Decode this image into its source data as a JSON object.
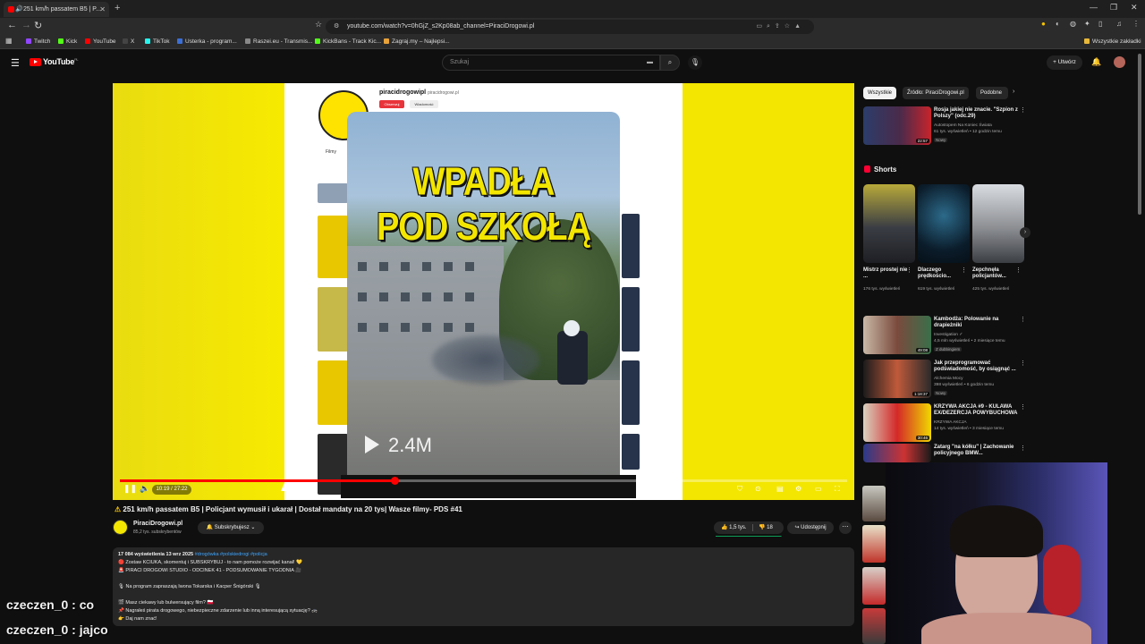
{
  "browser": {
    "tab_title": "251 km/h passatem B5 | P...",
    "url": "youtube.com/watch?v=0hGjZ_s2Kp08ab_channel=PiraciDrogowi.pl",
    "bookmarks": [
      "Twitch",
      "Kick",
      "YouTube",
      "X",
      "TikTok",
      "Usterka - program...",
      "Raszei.eu - Transmis...",
      "KickBans - Track Kic...",
      "Zagraj.my – Najlepsi..."
    ],
    "all_bookmarks": "Wszystkie zakładki"
  },
  "youtube": {
    "logo_word": "YouTube",
    "logo_region": "PL",
    "search_placeholder": "Szukaj",
    "create_label": "Utwórz"
  },
  "player": {
    "page_channel_name": "piracidrogowipl",
    "page_channel_handle": "piracidrogowi.pl",
    "page_subscribe": "Obserwuj",
    "page_message": "Wiadomość",
    "page_tab": "Filmy",
    "overlay_title_line1": "WPADŁA",
    "overlay_title_line2": "POD SZKOŁĄ",
    "overlay_views": "2.4M",
    "time": "10:19 / 27:22",
    "progress_fraction": 0.377
  },
  "video": {
    "title_warn": "⚠",
    "title": "251 km/h passatem B5 | Policjant wymusił i ukarał | Dostał mandaty na 20 tys| Wasze filmy- PDS #41",
    "channel": "PiraciDrogowi.pl",
    "subscribers": "85,2 tys. subskrybentów",
    "subscribed_label": "Subskrybujesz",
    "likes": "1,5 tys.",
    "dislikes": "18",
    "share_label": "Udostępnij",
    "like_ratio": 0.99
  },
  "description": {
    "meta": "17 084 wyświetlenia  13 wrz 2025",
    "tags": "#drogówka #polskiedrogi #policja",
    "lines": [
      "🔴 Zostaw KCIUKA, skomentuj i SUBSKRYBUJ - to nam pomoże rozwijać kanał! 💛",
      "🚨 PIRACI DROGOWI STUDIO - ODCINEK 41 - PODSUMOWANIE TYGODNIA 🎥",
      "",
      "🎙 Na program zapraszają Iwona Tokarska i Kacper Śnigórski 🎙",
      "",
      "🎬 Masz ciekawy lub bulwersujący film? 🇵🇱",
      "📌 Nagrałeś pirata drogowego, niebezpieczne zdarzenie lub inną interesującą sytuację? 🚓",
      "👉 Daj nam znać!"
    ]
  },
  "sidebar": {
    "chips": [
      "Wszystkie",
      "Źródło: PiraciDrogowi.pl",
      "Podobne"
    ],
    "top_video": {
      "title": "Rosja jakiej nie znacie. \"Szpion z Polszy\" (odc.29)",
      "channel": "Autostopem Na Koniec Świata",
      "meta": "61 tys. wyświetleń • 12 godzin temu",
      "badge": "Nowy",
      "duration": "22:57"
    },
    "shorts_heading": "Shorts",
    "shorts": [
      {
        "title": "Mistrz prostej nie ...",
        "views": "176 tys. wyświetleń"
      },
      {
        "title": "Dlaczego prędkościo...",
        "views": "619 tys. wyświetleń"
      },
      {
        "title": "Zepchnęła policjantów...",
        "views": "425 tys. wyświetleń"
      }
    ],
    "videos": [
      {
        "title": "Kambodża: Polowanie na drapieżniki",
        "channel": "Investigation ✓",
        "meta": "4,5 mln wyświetleń • 2 miesiące temu",
        "badge": "Z dubbingiem",
        "duration": "49:08"
      },
      {
        "title": "Jak przeprogramować podświadomość, by osiągnąć ...",
        "channel": "Alchemia Mocy",
        "meta": "398 wyświetleń • 6 godzin temu",
        "badge": "Nowy",
        "duration": "1:18:37"
      },
      {
        "title": "KRZYWA AKCJA #9 - KULAWA EX/DEZERCJA POWYBUCHOWA",
        "channel": "KRZYWA AKCJA",
        "meta": "14 tys. wyświetleń • 3 miesiące temu",
        "badge": "",
        "duration": "30:46"
      },
      {
        "title": "Zatarg \"na kółku\" | Zachowanie policyjnego BMW...",
        "channel": "",
        "meta": "",
        "badge": "",
        "duration": ""
      }
    ]
  },
  "chat": [
    {
      "user": "czeczen_0",
      "text": "co"
    },
    {
      "user": "czeczen_0",
      "text": "jajco"
    }
  ],
  "colors": {
    "accent": "#ff0000",
    "brand_yellow": "#f3e600",
    "background": "#0f0f0f",
    "link": "#3ea6ff"
  }
}
